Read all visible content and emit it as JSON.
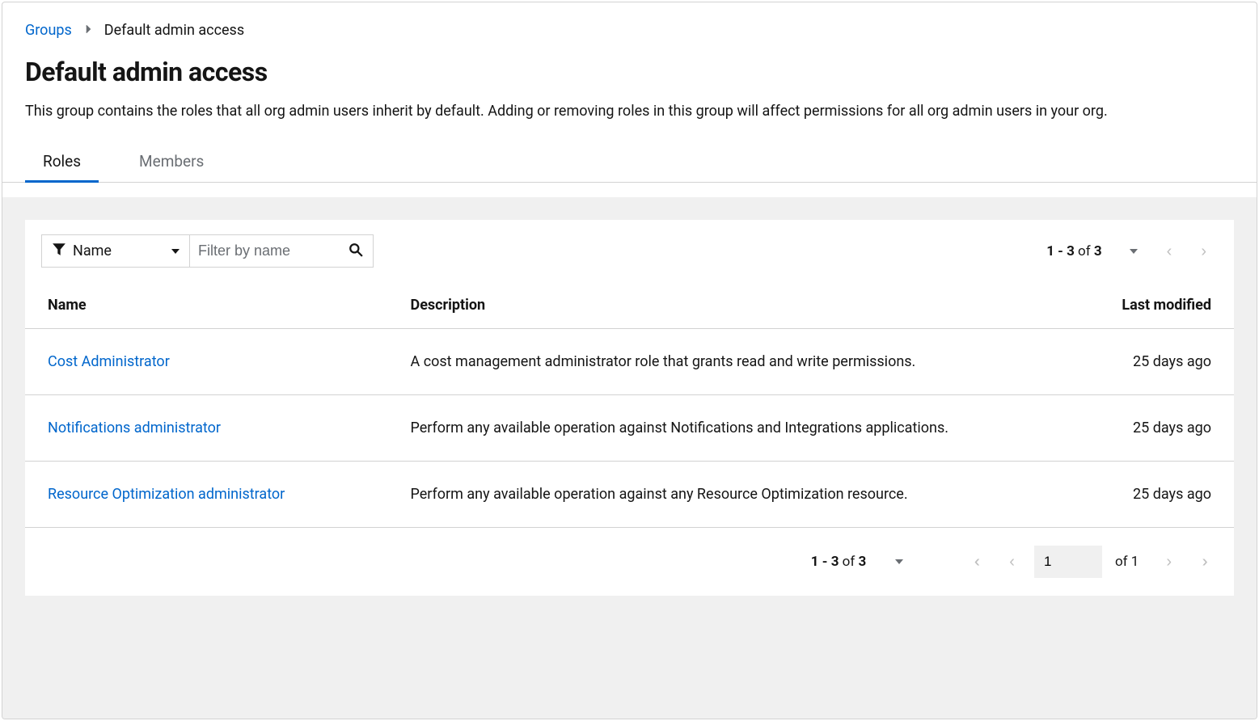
{
  "breadcrumb": {
    "parent": "Groups",
    "current": "Default admin access"
  },
  "header": {
    "title": "Default admin access",
    "description": "This group contains the roles that all org admin users inherit by default. Adding or removing roles in this group will affect permissions for all org admin users in your org."
  },
  "tabs": [
    {
      "label": "Roles",
      "active": true
    },
    {
      "label": "Members",
      "active": false
    }
  ],
  "toolbar": {
    "filter_field_label": "Name",
    "filter_placeholder": "Filter by name",
    "top_range": "1 - 3",
    "top_range_of": " of ",
    "top_total": "3"
  },
  "table": {
    "headers": {
      "name": "Name",
      "description": "Description",
      "modified": "Last modified"
    },
    "rows": [
      {
        "name": "Cost Administrator",
        "description": "A cost management administrator role that grants read and write permissions.",
        "modified": "25 days ago"
      },
      {
        "name": "Notifications administrator",
        "description": "Perform any available operation against Notifications and Integrations applications.",
        "modified": "25 days ago"
      },
      {
        "name": "Resource Optimization administrator",
        "description": "Perform any available operation against any Resource Optimization resource.",
        "modified": "25 days ago"
      }
    ]
  },
  "pagination": {
    "range": "1 - 3",
    "range_of": " of ",
    "total": "3",
    "page_input": "1",
    "of_pages_label": "of 1"
  }
}
